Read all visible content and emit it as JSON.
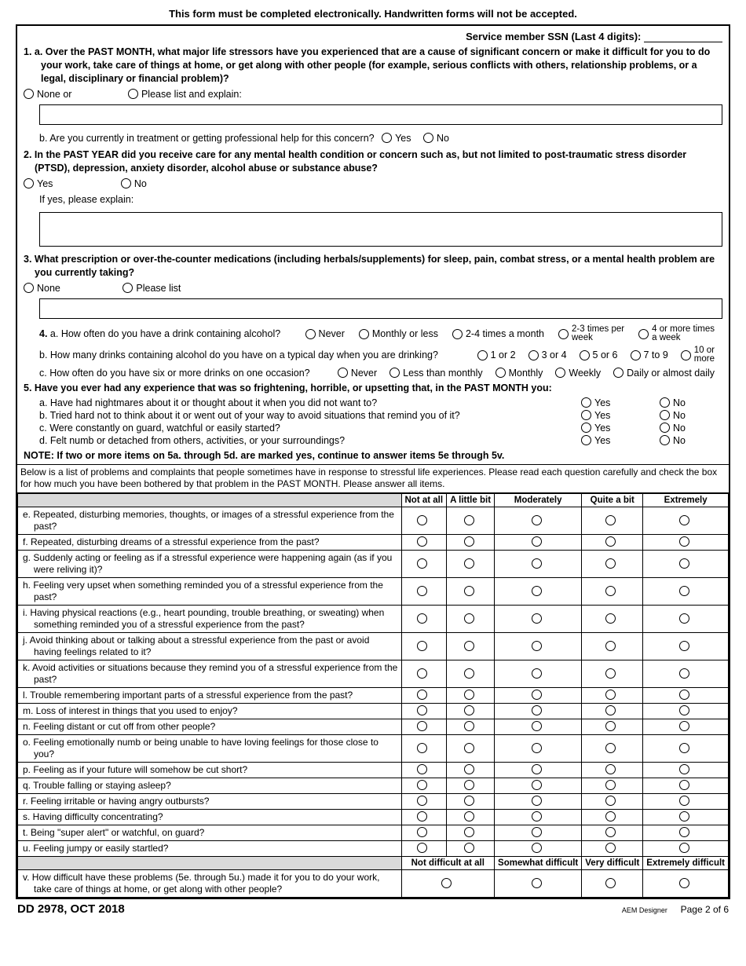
{
  "header_notice": "This form must be completed electronically. Handwritten forms will not be accepted.",
  "ssn_label": "Service member SSN (Last 4 digits):",
  "q1a": {
    "text": "1. a. Over the PAST MONTH, what major life stressors have you experienced that are a cause of significant concern or make it difficult for you to do your work, take care of things at home, or get along with other people (for example, serious conflicts with others, relationship problems, or a legal, disciplinary or financial problem)?",
    "opt_none": "None or",
    "opt_list": "Please list and explain:"
  },
  "q1b": {
    "text": "b. Are you currently in treatment or getting professional help for this concern?",
    "yes": "Yes",
    "no": "No"
  },
  "q2": {
    "text": "2. In the PAST YEAR did you receive care for any mental health condition or concern such as, but not limited to post-traumatic stress disorder (PTSD), depression, anxiety disorder, alcohol abuse or substance abuse?",
    "yes": "Yes",
    "no": "No",
    "explain": "If yes, please explain:"
  },
  "q3": {
    "text": "3. What prescription or over-the-counter medications (including herbals/supplements) for sleep, pain, combat stress, or a mental health problem are you currently taking?",
    "opt_none": "None",
    "opt_list": "Please list"
  },
  "q4a": {
    "lead": "4.",
    "text": "a. How often do you have a drink containing alcohol?",
    "opts": [
      "Never",
      "Monthly or less",
      "2-4 times a month",
      "2-3 times per week",
      "4 or more times a week"
    ]
  },
  "q4b": {
    "text": "b. How many drinks containing alcohol do you have on a typical day when you are drinking?",
    "opts": [
      "1 or 2",
      "3 or 4",
      "5 or 6",
      "7 to 9",
      "10 or more"
    ]
  },
  "q4c": {
    "text": "c. How often do you have six or more drinks on one occasion?",
    "opts": [
      "Never",
      "Less than monthly",
      "Monthly",
      "Weekly",
      "Daily or almost daily"
    ]
  },
  "q5": {
    "text": "5. Have you ever had any experience that was so frightening, horrible, or upsetting that, in the PAST MONTH you:",
    "yes": "Yes",
    "no": "No",
    "items": [
      "a. Have had nightmares about it or thought about it when you did not want to?",
      "b. Tried hard not to think about it or went out of your way to avoid situations that remind you of it?",
      "c. Were constantly on guard, watchful or easily started?",
      "d. Felt numb or detached from others, activities, or your surroundings?"
    ]
  },
  "note": "NOTE: If two or more items on 5a. through 5d. are marked yes, continue to answer items 5e through 5v.",
  "instr": "Below is a list of problems and complaints that people sometimes have in response to stressful life experiences. Please read each question carefully and check the box for how much you have been bothered by that problem in the PAST MONTH. Please answer all items.",
  "cols": [
    "Not at all",
    "A little bit",
    "Moderately",
    "Quite a bit",
    "Extremely"
  ],
  "grid": [
    "e. Repeated, disturbing memories, thoughts, or images of a stressful experience from the past?",
    "f. Repeated, disturbing dreams of a stressful experience from the past?",
    "g. Suddenly acting or feeling as if a stressful experience were happening again (as if you were reliving it)?",
    "h. Feeling very upset when something reminded you of a stressful experience from the past?",
    "i. Having physical reactions (e.g., heart pounding, trouble breathing, or sweating) when something reminded you of a stressful experience from the past?",
    "j. Avoid thinking about or talking about a stressful experience from the past or avoid having feelings related to it?",
    "k. Avoid activities or situations because they remind you of a stressful experience from the past?",
    "l. Trouble remembering important parts of a stressful experience from the past?",
    "m. Loss of interest in things that you used to enjoy?",
    "n. Feeling distant or cut off from other people?",
    "o. Feeling emotionally numb or being unable to have loving feelings for those close to you?",
    "p. Feeling as if your future will somehow be cut short?",
    "q. Trouble falling or staying asleep?",
    "r. Feeling irritable or having angry outbursts?",
    "s. Having difficulty concentrating?",
    "t. Being \"super alert\" or watchful, on guard?",
    "u. Feeling jumpy or easily startled?"
  ],
  "diffcols": [
    "Not difficult at all",
    "Somewhat difficult",
    "Very difficult",
    "Extremely difficult"
  ],
  "q5v": "v. How difficult have these problems (5e. through 5u.) made it for you to do your work, take care of things at home, or get along with other people?",
  "footer": {
    "left": "DD 2978, OCT 2018",
    "mid": "AEM Designer",
    "right": "Page 2 of 6"
  }
}
